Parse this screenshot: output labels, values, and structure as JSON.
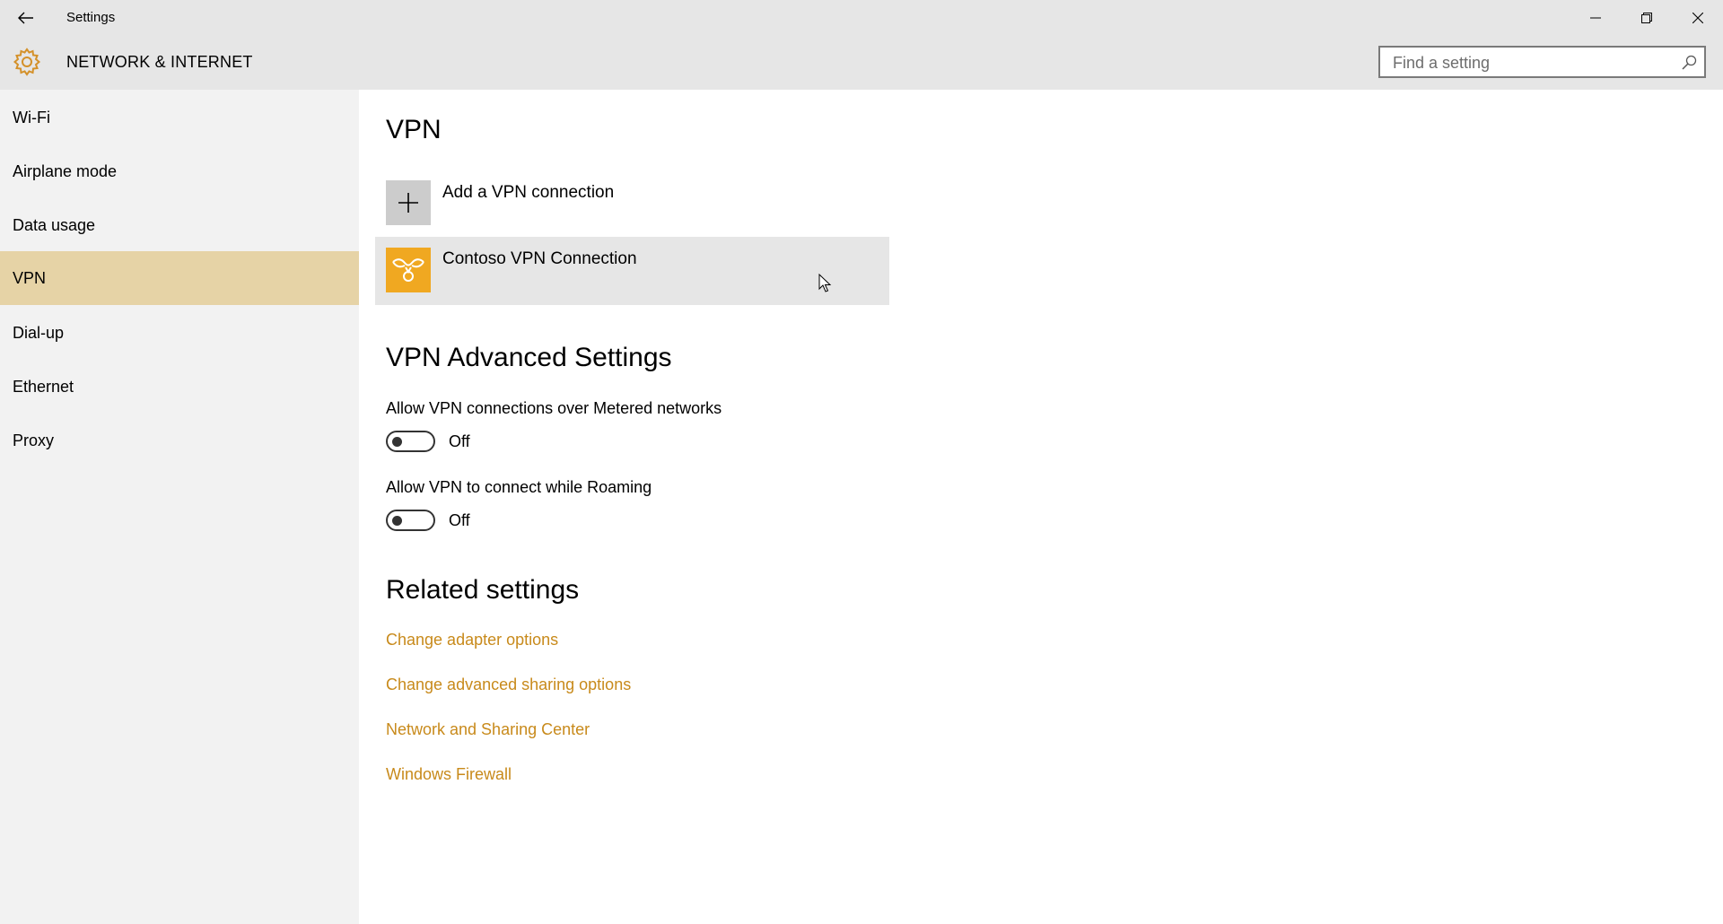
{
  "window": {
    "title": "Settings",
    "section": "NETWORK & INTERNET"
  },
  "search": {
    "placeholder": "Find a setting",
    "value": ""
  },
  "sidebar": {
    "items": [
      {
        "label": "Wi-Fi"
      },
      {
        "label": "Airplane mode"
      },
      {
        "label": "Data usage"
      },
      {
        "label": "VPN",
        "selected": true
      },
      {
        "label": "Dial-up"
      },
      {
        "label": "Ethernet"
      },
      {
        "label": "Proxy"
      }
    ]
  },
  "main": {
    "title": "VPN",
    "add_connection_label": "Add a VPN connection",
    "connections": [
      {
        "name": "Contoso VPN Connection",
        "icon": "vpn-connection-icon"
      }
    ],
    "advanced": {
      "title": "VPN Advanced Settings",
      "settings": [
        {
          "label": "Allow VPN connections over Metered networks",
          "state": "Off"
        },
        {
          "label": "Allow VPN to connect while Roaming",
          "state": "Off"
        }
      ]
    },
    "related": {
      "title": "Related settings",
      "links": [
        {
          "label": "Change adapter options"
        },
        {
          "label": "Change advanced sharing options"
        },
        {
          "label": "Network and Sharing Center"
        },
        {
          "label": "Windows Firewall"
        }
      ]
    }
  },
  "colors": {
    "accent": "#f0a821",
    "link": "#c88a1b",
    "selected_nav": "#e6d3a6",
    "titlebar": "#e6e6e6",
    "sidebar": "#f2f2f2"
  },
  "icons": [
    "back-arrow-icon",
    "settings-gear-icon",
    "search-icon",
    "minimize-icon",
    "restore-icon",
    "close-icon",
    "plus-icon",
    "vpn-connection-icon",
    "mouse-cursor-icon"
  ]
}
